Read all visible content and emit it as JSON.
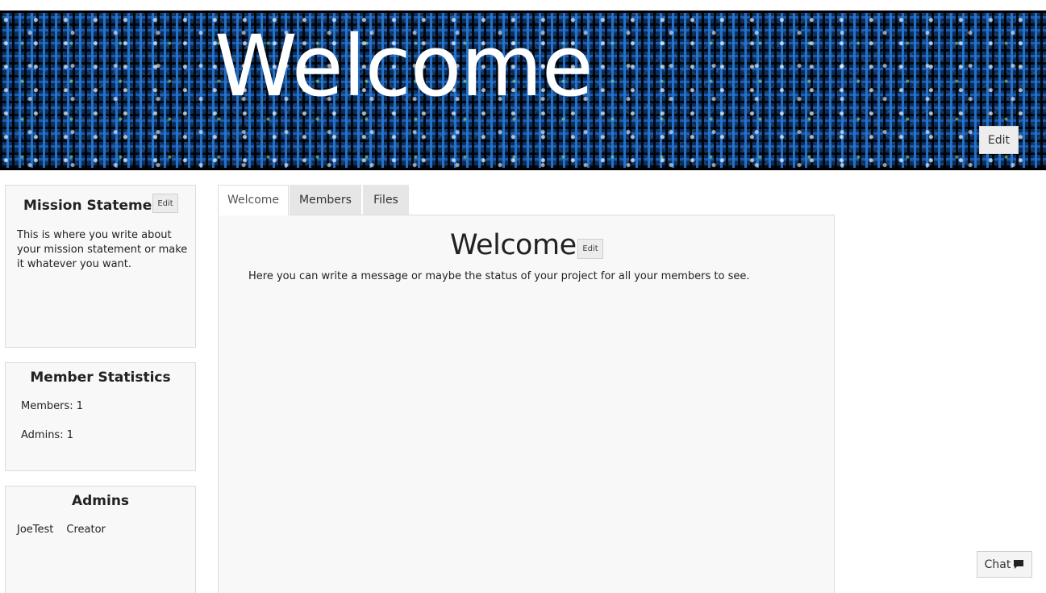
{
  "banner": {
    "title": "Welcome",
    "edit_label": "Edit"
  },
  "sidebar": {
    "mission": {
      "title": "Mission Statement",
      "edit_label": "Edit",
      "text": "This is where you write about your mission statement or make it whatever you want."
    },
    "stats": {
      "title": "Member Statistics",
      "members": "Members: 1",
      "admins": "Admins: 1"
    },
    "admins": {
      "title": "Admins",
      "items": [
        {
          "name": "JoeTest",
          "role": "Creator"
        }
      ]
    }
  },
  "tabs": [
    {
      "label": "Welcome",
      "active": true
    },
    {
      "label": "Members",
      "active": false
    },
    {
      "label": "Files",
      "active": false
    }
  ],
  "main": {
    "title": "Welcome",
    "edit_label": "Edit",
    "text": "Here you can write a message or maybe the status of your project for all your members to see."
  },
  "chat": {
    "label": "Chat",
    "icon": "comment-icon"
  },
  "colors": {
    "banner": "#0b2e5c",
    "panel_bg": "#f8f8f8",
    "tab_inactive": "#e6e6e6"
  }
}
